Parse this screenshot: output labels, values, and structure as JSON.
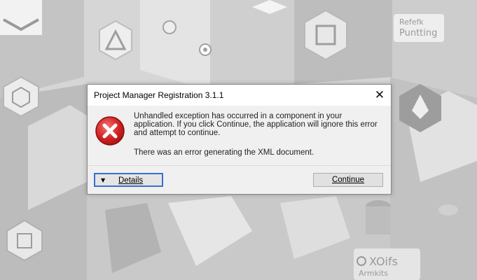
{
  "background": {
    "labels": [
      "Refefk",
      "Puntting",
      "XOifs",
      "Armkits"
    ]
  },
  "dialog": {
    "title": "Project Manager Registration 3.1.1",
    "close_glyph": "✕",
    "icon": "error-icon",
    "message_line1": "Unhandled exception has occurred in a component in your",
    "message_line2": "application. If you click Continue, the application will ignore this error",
    "message_line3": "and attempt to continue.",
    "message_detail": "There was an error generating the XML document.",
    "details_label": "Details",
    "continue_label": "Continue",
    "colors": {
      "error_red": "#d32424",
      "focus_blue": "#3b6fd0"
    }
  }
}
